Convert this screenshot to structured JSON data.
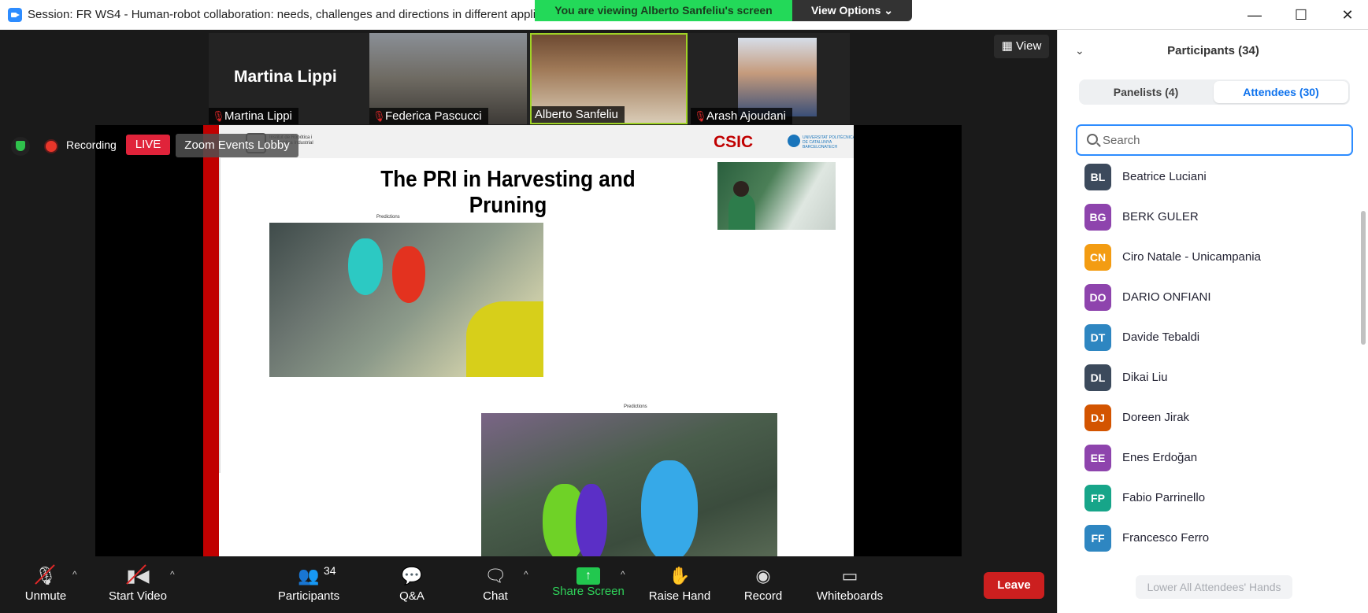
{
  "window": {
    "title": "Session: FR WS4 - Human-robot collaboration: needs, challenges and directions in different appli",
    "viewing_banner": "You are viewing Alberto Sanfeliu's screen",
    "view_options": "View Options ⌄",
    "minimize": "—",
    "maximize": "☐",
    "close": "✕"
  },
  "thumbnails": [
    {
      "name": "Martina Lippi",
      "big_name": "Martina Lippi",
      "muted": true
    },
    {
      "name": "Federica Pascucci",
      "muted": true
    },
    {
      "name": "Alberto Sanfeliu",
      "muted": false
    },
    {
      "name": "Arash Ajoudani",
      "muted": true
    }
  ],
  "view_button": "View",
  "status": {
    "recording": "Recording",
    "live": "LIVE",
    "lobby": "Zoom Events Lobby"
  },
  "slide": {
    "title": "The PRI in Harvesting and Pruning",
    "prediction_label_1": "Predictions",
    "prediction_label_2": "Predictions",
    "csic_logo": "CSIC",
    "upc_text": "UNIVERSITAT POLITÈCNICA DE CATALUNYA BARCELONATECH",
    "iri_text": "Institut de Robòtica i Informàtica Industrial"
  },
  "toolbar": {
    "unmute": "Unmute",
    "start_video": "Start Video",
    "participants": "Participants",
    "participants_count": "34",
    "qa": "Q&A",
    "chat": "Chat",
    "share_screen": "Share Screen",
    "raise_hand": "Raise Hand",
    "record": "Record",
    "whiteboards": "Whiteboards",
    "leave": "Leave"
  },
  "panel": {
    "title": "Participants (34)",
    "panelists_tab": "Panelists (4)",
    "attendees_tab": "Attendees (30)",
    "search_placeholder": "Search",
    "attendees": [
      {
        "initials": "BL",
        "name": "Beatrice Luciani",
        "color": "#3c4a5c"
      },
      {
        "initials": "BG",
        "name": "BERK GULER",
        "color": "#8e44ad"
      },
      {
        "initials": "CN",
        "name": "Ciro Natale - Unicampania",
        "color": "#f39c12"
      },
      {
        "initials": "DO",
        "name": "DARIO ONFIANI",
        "color": "#8e44ad"
      },
      {
        "initials": "DT",
        "name": "Davide Tebaldi",
        "color": "#2e86c1"
      },
      {
        "initials": "DL",
        "name": "Dikai Liu",
        "color": "#3c4a5c"
      },
      {
        "initials": "DJ",
        "name": "Doreen Jirak",
        "color": "#d35400"
      },
      {
        "initials": "EE",
        "name": "Enes Erdoğan",
        "color": "#8e44ad"
      },
      {
        "initials": "FP",
        "name": "Fabio Parrinello",
        "color": "#17a589"
      },
      {
        "initials": "FF",
        "name": "Francesco Ferro",
        "color": "#2e86c1"
      }
    ],
    "lower_hands": "Lower All Attendees' Hands"
  }
}
